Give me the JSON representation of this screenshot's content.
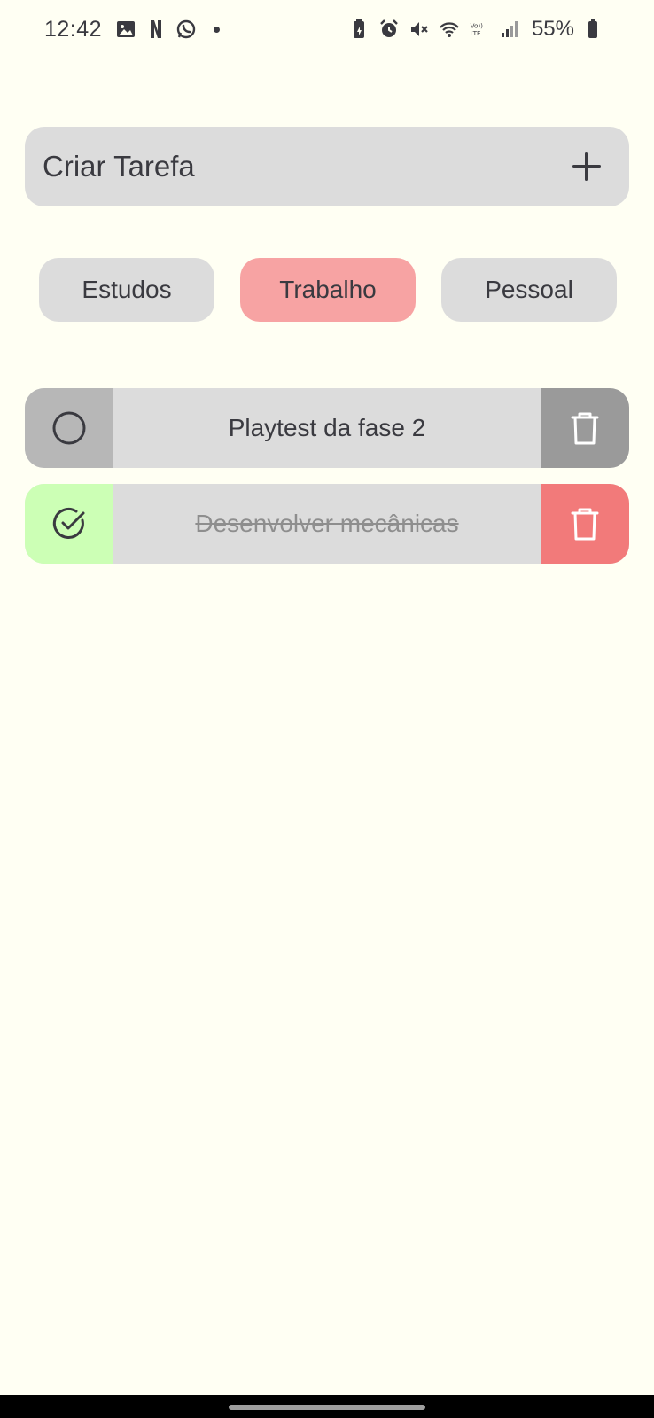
{
  "status_bar": {
    "time": "12:42",
    "battery_percent": "55%",
    "left_icons": [
      "image-icon",
      "netflix-icon",
      "whatsapp-icon",
      "notification-dot"
    ],
    "right_icons": [
      "battery-saver-icon",
      "alarm-icon",
      "mute-icon",
      "wifi-icon",
      "volte-icon",
      "signal-icon",
      "battery-icon"
    ],
    "volte_label": "Vo)) LTE"
  },
  "create_task": {
    "label": "Criar Tarefa",
    "icon": "plus-icon"
  },
  "categories": {
    "selected": "Trabalho",
    "items": [
      {
        "label": "Estudos",
        "active": false
      },
      {
        "label": "Trabalho",
        "active": true
      },
      {
        "label": "Pessoal",
        "active": false
      }
    ]
  },
  "tasks": [
    {
      "text": "Playtest da fase 2",
      "done": false,
      "check_icon": "circle-icon",
      "delete_icon": "trash-icon"
    },
    {
      "text": "Desenvolver mecânicas",
      "done": true,
      "check_icon": "check-circle-icon",
      "delete_icon": "trash-icon"
    }
  ],
  "colors": {
    "background": "#fffff3",
    "surface": "#dcdcdc",
    "active_chip": "#f7a3a3",
    "pending_check": "#b7b7b7",
    "pending_delete": "#9a9a9a",
    "done_check": "#ccffb5",
    "done_delete": "#f27a7a",
    "text": "#3a3a40"
  }
}
